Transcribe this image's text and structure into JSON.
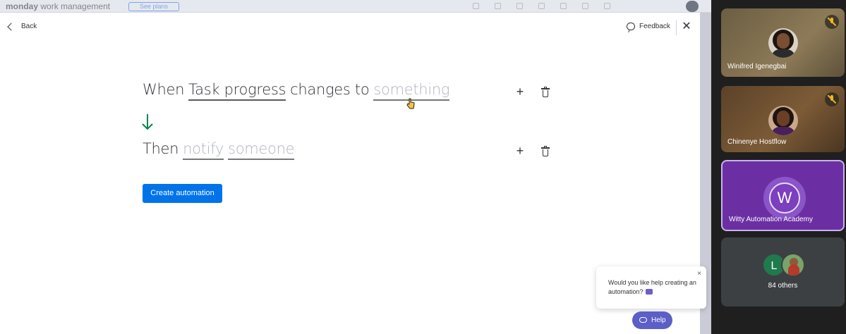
{
  "app": {
    "brand": "monday",
    "brand_sub": "work management",
    "see_plans": "See plans"
  },
  "modal": {
    "back_label": "Back",
    "feedback_label": "Feedback",
    "close_symbol": "✕"
  },
  "recipe": {
    "trigger": {
      "when": "When",
      "column": "Task progress",
      "changes_to": "changes to",
      "value": "something"
    },
    "action": {
      "then": "Then",
      "verb": "notify",
      "target": "someone"
    },
    "plus_symbol": "+",
    "create_button": "Create automation"
  },
  "help": {
    "message": "Would you like help creating an automation?",
    "close_symbol": "×",
    "button_label": "Help"
  },
  "participants": [
    {
      "name": "Winifred Igenegbai",
      "muted": true
    },
    {
      "name": "Chinenye Hostflow",
      "muted": true
    },
    {
      "name": "Witty Automation Academy",
      "initial": "W",
      "active_speaker": true
    },
    {
      "name": "84 others",
      "initial": "L"
    }
  ],
  "colors": {
    "primary_button": "#0073ea",
    "arrow_green": "#00854d",
    "help_button": "#5b5fc7",
    "speaker_tile": "#6b2fa3"
  }
}
